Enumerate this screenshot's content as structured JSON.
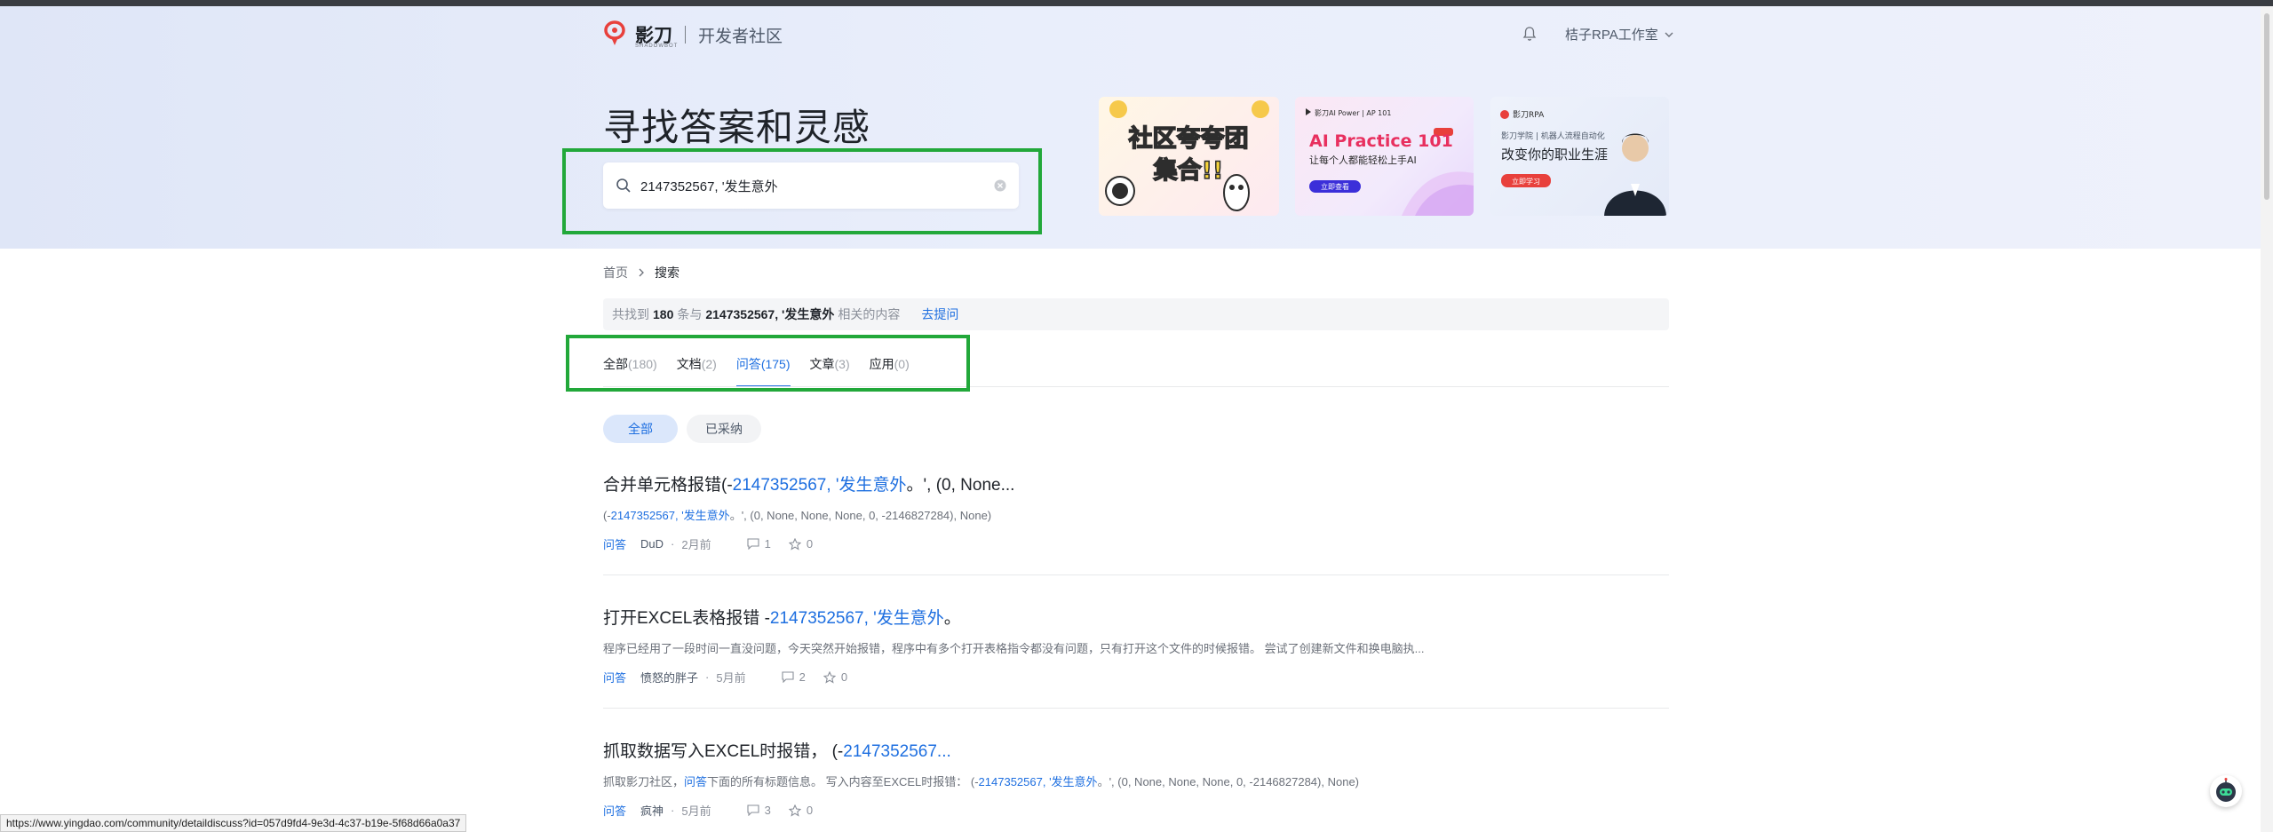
{
  "header": {
    "logo_text": "影刀",
    "logo_sub": "SHADOWBOT",
    "community": "开发者社区",
    "user_name": "桔子RPA工作室"
  },
  "hero": {
    "title": "寻找答案和灵感"
  },
  "search": {
    "value": "2147352567, '发生意外"
  },
  "banners": [
    {
      "line1": "社区夸夸团",
      "line2": "集合!!"
    },
    {
      "brand": "影刀AI Power | AP 101",
      "title": "AI Practice 101",
      "subtitle": "让每个人都能轻松上手AI",
      "cta": "立即查看"
    },
    {
      "brand": "影刀RPA",
      "line1": "影刀学院 | 机器人流程自动化",
      "line2": "改变你的职业生涯",
      "cta": "立即学习"
    }
  ],
  "breadcrumb": {
    "home": "首页",
    "current": "搜索"
  },
  "result_bar": {
    "prefix": "共找到",
    "count": "180",
    "mid": "条与",
    "keyword": "2147352567, '发生意外",
    "suffix": "相关的内容",
    "ask": "去提问"
  },
  "tabs": [
    {
      "label": "全部",
      "count": "(180)"
    },
    {
      "label": "文档",
      "count": "(2)"
    },
    {
      "label": "问答",
      "count": "(175)"
    },
    {
      "label": "文章",
      "count": "(3)"
    },
    {
      "label": "应用",
      "count": "(0)"
    }
  ],
  "filters": {
    "all": "全部",
    "adopted": "已采纳"
  },
  "results": [
    {
      "title_pre": "合并单元格报错(-",
      "title_kw": "2147352567, '发生意外",
      "title_post": "。', (0, None...",
      "summary_pre": "(-",
      "summary_kw": "2147352567, '发生意外",
      "summary_post": "。', (0, None, None, None, 0, -2146827284), None)",
      "type": "问答",
      "author": "DuD",
      "time": "2月前",
      "comments": "1",
      "stars": "0"
    },
    {
      "title_pre": "打开EXCEL表格报错 -",
      "title_kw": "2147352567, '发生意外",
      "title_post": "。",
      "summary": "程序已经用了一段时间一直没问题，今天突然开始报错，程序中有多个打开表格指令都没有问题，只有打开这个文件的时候报错。 尝试了创建新文件和换电脑执...",
      "type": "问答",
      "author": "愤怒的胖子",
      "time": "5月前",
      "comments": "2",
      "stars": "0"
    },
    {
      "title_pre": "抓取数据写入EXCEL时报错， (-",
      "title_kw": "2147352567...",
      "summary_pre": "抓取影刀社区，",
      "summary_kw1": "问答",
      "summary_mid": "下面的所有标题信息。 写入内容至EXCEL时报错： (-",
      "summary_kw2": "2147352567, '发生意外",
      "summary_post": "。', (0, None, None, None, 0, -2146827284), None)",
      "type": "问答",
      "author": "疯神",
      "time": "5月前",
      "comments": "3",
      "stars": "0"
    }
  ],
  "status_url": "https://www.yingdao.com/community/detaildiscuss?id=057d9fd4-9e3d-4c37-b19e-5f68d66a0a37",
  "colors": {
    "accent": "#1e6fe0",
    "highlight_box": "#22a83a",
    "logo_red": "#e8403c"
  }
}
